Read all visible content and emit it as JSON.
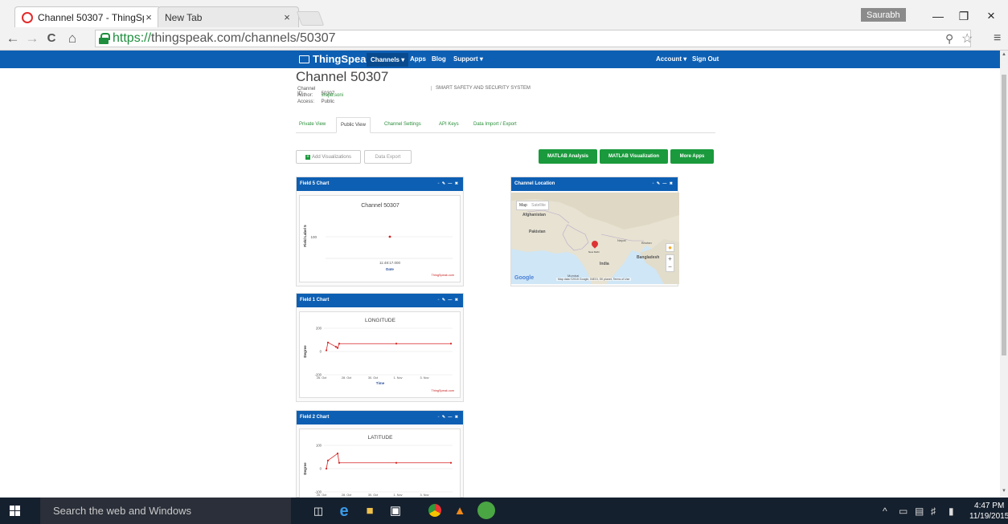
{
  "browser": {
    "tabs": [
      {
        "title": "Channel 50307 - ThingSpe",
        "close": "×",
        "favicon": "thingspeak-icon"
      },
      {
        "title": "New Tab",
        "close": "×"
      }
    ],
    "user": "Saurabh",
    "window": {
      "minimize": "—",
      "restore": "❐",
      "close": "×"
    },
    "nav": {
      "back": "←",
      "forward": "→",
      "reload": "C",
      "home": "⌂"
    },
    "url": {
      "protocol": "https://",
      "rest": "thingspeak.com/channels/50307"
    }
  },
  "navbar": {
    "logo": "ThingSpeak",
    "items": [
      "Channels ▾",
      "Apps",
      "Blog",
      "Support ▾"
    ],
    "right": [
      "Account ▾",
      "Sign Out"
    ]
  },
  "channel": {
    "title": "Channel 50307",
    "meta": [
      {
        "key": "Channel ID:",
        "value": "50307"
      },
      {
        "key": "Author:",
        "value": "srajat.soni"
      },
      {
        "key": "Access:",
        "value": "Public"
      }
    ],
    "description": "SMART SAFETY AND SECURITY SYSTEM"
  },
  "page_tabs": [
    "Private View",
    "Public View",
    "Channel Settings",
    "API Keys",
    "Data Import / Export"
  ],
  "actions": {
    "add_viz": "Add Visualizations",
    "data_export": "Data Export",
    "matlab_analysis": "MATLAB Analysis",
    "matlab_viz": "MATLAB Visualization",
    "more_apps": "More Apps"
  },
  "widgets": {
    "field5": {
      "header": "Field 5 Chart",
      "tools": "▫ ✎ — ✖"
    },
    "location": {
      "header": "Channel Location",
      "tools": "▫ ✎ — ✖"
    },
    "field1": {
      "header": "Field 1 Chart",
      "tools": "▫ ✎ — ✖"
    },
    "field2": {
      "header": "Field 2 Chart",
      "tools": "▫ ✎ — ✖"
    }
  },
  "chart_data": [
    {
      "type": "scatter",
      "title": "Channel 50307",
      "xlabel": "Date",
      "ylabel": "Field Label 5",
      "x_tick": "11:48:17.000",
      "y_tick": "100",
      "points": [
        {
          "x": "11:48:17.000",
          "y": 100
        }
      ],
      "credit": "ThingSpeak.com"
    },
    {
      "type": "line",
      "title": "LONGITUDE",
      "xlabel": "Time",
      "ylabel": "Degree",
      "yticks": [
        "200",
        "0",
        "-200"
      ],
      "xticks": [
        "26. Oct",
        "28. Oct",
        "30. Oct",
        "1. Nov",
        "3. Nov"
      ],
      "ylim": [
        -200,
        200
      ],
      "series": [
        {
          "values": [
            10,
            77,
            40,
            30,
            67,
            67,
            67
          ]
        }
      ],
      "credit": "ThingSpeak.com"
    },
    {
      "type": "line",
      "title": "LATITUDE",
      "xlabel": "",
      "ylabel": "Degree",
      "yticks": [
        "100",
        "0",
        "-100"
      ],
      "xticks": [
        "26. Oct",
        "28. Oct",
        "30. Oct",
        "1. Nov",
        "3. Nov"
      ],
      "ylim": [
        -100,
        100
      ],
      "series": [
        {
          "values": [
            0,
            35,
            65,
            25,
            25,
            25
          ]
        }
      ]
    }
  ],
  "map": {
    "tabs": [
      "Map",
      "Satellite"
    ],
    "labels": [
      "Afghanistan",
      "Pakistan",
      "Nepal",
      "Bhutan",
      "Bangladesh",
      "India",
      "Mumbai",
      "New Delhi",
      "Google"
    ],
    "attribution": "Map data ©2015 Google, INEGI, SK planet,  Terms of Use",
    "zoom_in": "+",
    "zoom_out": "−"
  },
  "taskbar": {
    "search": "Search the web and Windows",
    "time": "4:47 PM",
    "date": "11/19/2015"
  }
}
